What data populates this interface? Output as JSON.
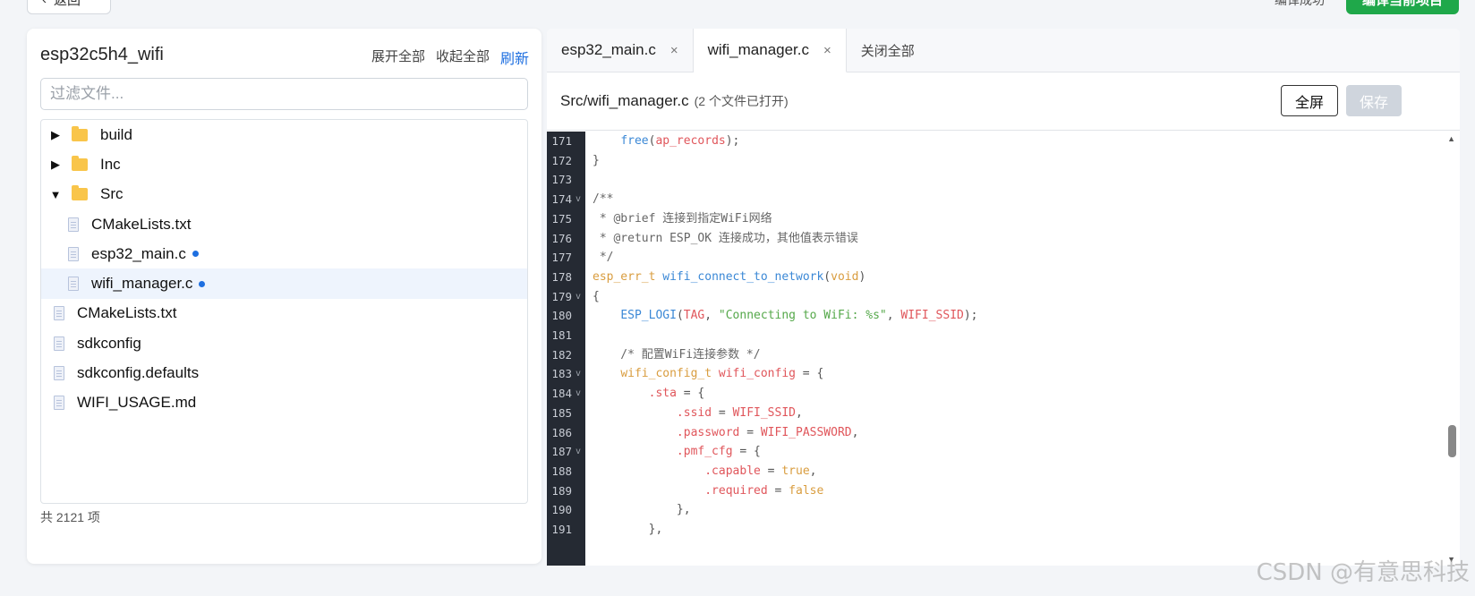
{
  "top": {
    "back_label": "返回",
    "back_icon": "chevron-left-icon",
    "status_text": "编译成功",
    "compile_button": "编译当前项目"
  },
  "left": {
    "project_name": "esp32c5h4_wifi",
    "expand_all": "展开全部",
    "collapse_all": "收起全部",
    "refresh": "刷新",
    "filter_placeholder": "过滤文件...",
    "tree": [
      {
        "label": "build",
        "type": "folder",
        "expanded": false,
        "level": 0
      },
      {
        "label": "Inc",
        "type": "folder",
        "expanded": false,
        "level": 0
      },
      {
        "label": "Src",
        "type": "folder",
        "expanded": true,
        "level": 0
      },
      {
        "label": "CMakeLists.txt",
        "type": "file",
        "level": 1
      },
      {
        "label": "esp32_main.c",
        "type": "file",
        "level": 1,
        "modified": true
      },
      {
        "label": "wifi_manager.c",
        "type": "file",
        "level": 1,
        "modified": true,
        "selected": true
      },
      {
        "label": "CMakeLists.txt",
        "type": "file",
        "level": 0
      },
      {
        "label": "sdkconfig",
        "type": "file",
        "level": 0
      },
      {
        "label": "sdkconfig.defaults",
        "type": "file",
        "level": 0
      },
      {
        "label": "WIFI_USAGE.md",
        "type": "file",
        "level": 0
      }
    ],
    "count": "共 2121 项",
    "arrow_collapsed": "▶",
    "arrow_expanded": "▼"
  },
  "right": {
    "tabs": [
      {
        "label": "esp32_main.c",
        "close": "×",
        "active": false
      },
      {
        "label": "wifi_manager.c",
        "close": "×",
        "active": true
      }
    ],
    "close_all": "关闭全部",
    "file_path": "Src/wifi_manager.c",
    "open_count": "(2 个文件已打开)",
    "fullscreen": "全屏",
    "save": "保存",
    "code": [
      {
        "n": "171",
        "fold": "",
        "seg": [
          {
            "t": "    "
          },
          {
            "t": "free",
            "c": "fn"
          },
          {
            "t": "("
          },
          {
            "t": "ap_records",
            "c": "var"
          },
          {
            "t": ");"
          }
        ]
      },
      {
        "n": "172",
        "fold": "",
        "seg": [
          {
            "t": "}"
          }
        ]
      },
      {
        "n": "173",
        "fold": "",
        "seg": []
      },
      {
        "n": "174",
        "fold": "v",
        "seg": [
          {
            "t": "/**",
            "c": "cm"
          }
        ]
      },
      {
        "n": "175",
        "fold": "",
        "seg": [
          {
            "t": " * @brief 连接到指定WiFi网络",
            "c": "cm"
          }
        ]
      },
      {
        "n": "176",
        "fold": "",
        "seg": [
          {
            "t": " * @return ESP_OK 连接成功，其他值表示错误",
            "c": "cm"
          }
        ]
      },
      {
        "n": "177",
        "fold": "",
        "seg": [
          {
            "t": " */",
            "c": "cm"
          }
        ]
      },
      {
        "n": "178",
        "fold": "",
        "seg": [
          {
            "t": "esp_err_t",
            "c": "kw"
          },
          {
            "t": " "
          },
          {
            "t": "wifi_connect_to_network",
            "c": "fn"
          },
          {
            "t": "("
          },
          {
            "t": "void",
            "c": "kw"
          },
          {
            "t": ")"
          }
        ]
      },
      {
        "n": "179",
        "fold": "v",
        "seg": [
          {
            "t": "{"
          }
        ]
      },
      {
        "n": "180",
        "fold": "",
        "seg": [
          {
            "t": "    "
          },
          {
            "t": "ESP_LOGI",
            "c": "fn"
          },
          {
            "t": "("
          },
          {
            "t": "TAG",
            "c": "var"
          },
          {
            "t": ", "
          },
          {
            "t": "\"Connecting to WiFi: %s\"",
            "c": "str"
          },
          {
            "t": ", "
          },
          {
            "t": "WIFI_SSID",
            "c": "var"
          },
          {
            "t": ");"
          }
        ]
      },
      {
        "n": "181",
        "fold": "",
        "seg": []
      },
      {
        "n": "182",
        "fold": "",
        "seg": [
          {
            "t": "    /* 配置WiFi连接参数 */",
            "c": "cm"
          }
        ]
      },
      {
        "n": "183",
        "fold": "v",
        "seg": [
          {
            "t": "    "
          },
          {
            "t": "wifi_config_t",
            "c": "kw"
          },
          {
            "t": " "
          },
          {
            "t": "wifi_config",
            "c": "var"
          },
          {
            "t": " = {"
          }
        ]
      },
      {
        "n": "184",
        "fold": "v",
        "seg": [
          {
            "t": "        "
          },
          {
            "t": ".sta",
            "c": "var"
          },
          {
            "t": " = {"
          }
        ]
      },
      {
        "n": "185",
        "fold": "",
        "seg": [
          {
            "t": "            "
          },
          {
            "t": ".ssid",
            "c": "var"
          },
          {
            "t": " = "
          },
          {
            "t": "WIFI_SSID",
            "c": "var"
          },
          {
            "t": ","
          }
        ]
      },
      {
        "n": "186",
        "fold": "",
        "seg": [
          {
            "t": "            "
          },
          {
            "t": ".password",
            "c": "var"
          },
          {
            "t": " = "
          },
          {
            "t": "WIFI_PASSWORD",
            "c": "var"
          },
          {
            "t": ","
          }
        ]
      },
      {
        "n": "187",
        "fold": "v",
        "seg": [
          {
            "t": "            "
          },
          {
            "t": ".pmf_cfg",
            "c": "var"
          },
          {
            "t": " = {"
          }
        ]
      },
      {
        "n": "188",
        "fold": "",
        "seg": [
          {
            "t": "                "
          },
          {
            "t": ".capable",
            "c": "var"
          },
          {
            "t": " = "
          },
          {
            "t": "true",
            "c": "kw"
          },
          {
            "t": ","
          }
        ]
      },
      {
        "n": "189",
        "fold": "",
        "seg": [
          {
            "t": "                "
          },
          {
            "t": ".required",
            "c": "var"
          },
          {
            "t": " = "
          },
          {
            "t": "false",
            "c": "kw"
          }
        ]
      },
      {
        "n": "190",
        "fold": "",
        "seg": [
          {
            "t": "            },"
          }
        ]
      },
      {
        "n": "191",
        "fold": "",
        "seg": [
          {
            "t": "        },"
          }
        ]
      }
    ],
    "scroll_up": "▲",
    "scroll_down": "▼"
  },
  "watermark": "CSDN @有意思科技",
  "colors": {
    "accent": "#1e6fe0",
    "compile_green": "#1fa84a",
    "gutter_bg": "#252a33",
    "keyword": "#d99d3f",
    "function": "#3b88d6",
    "string": "#55a84a",
    "variable": "#e0565b"
  }
}
